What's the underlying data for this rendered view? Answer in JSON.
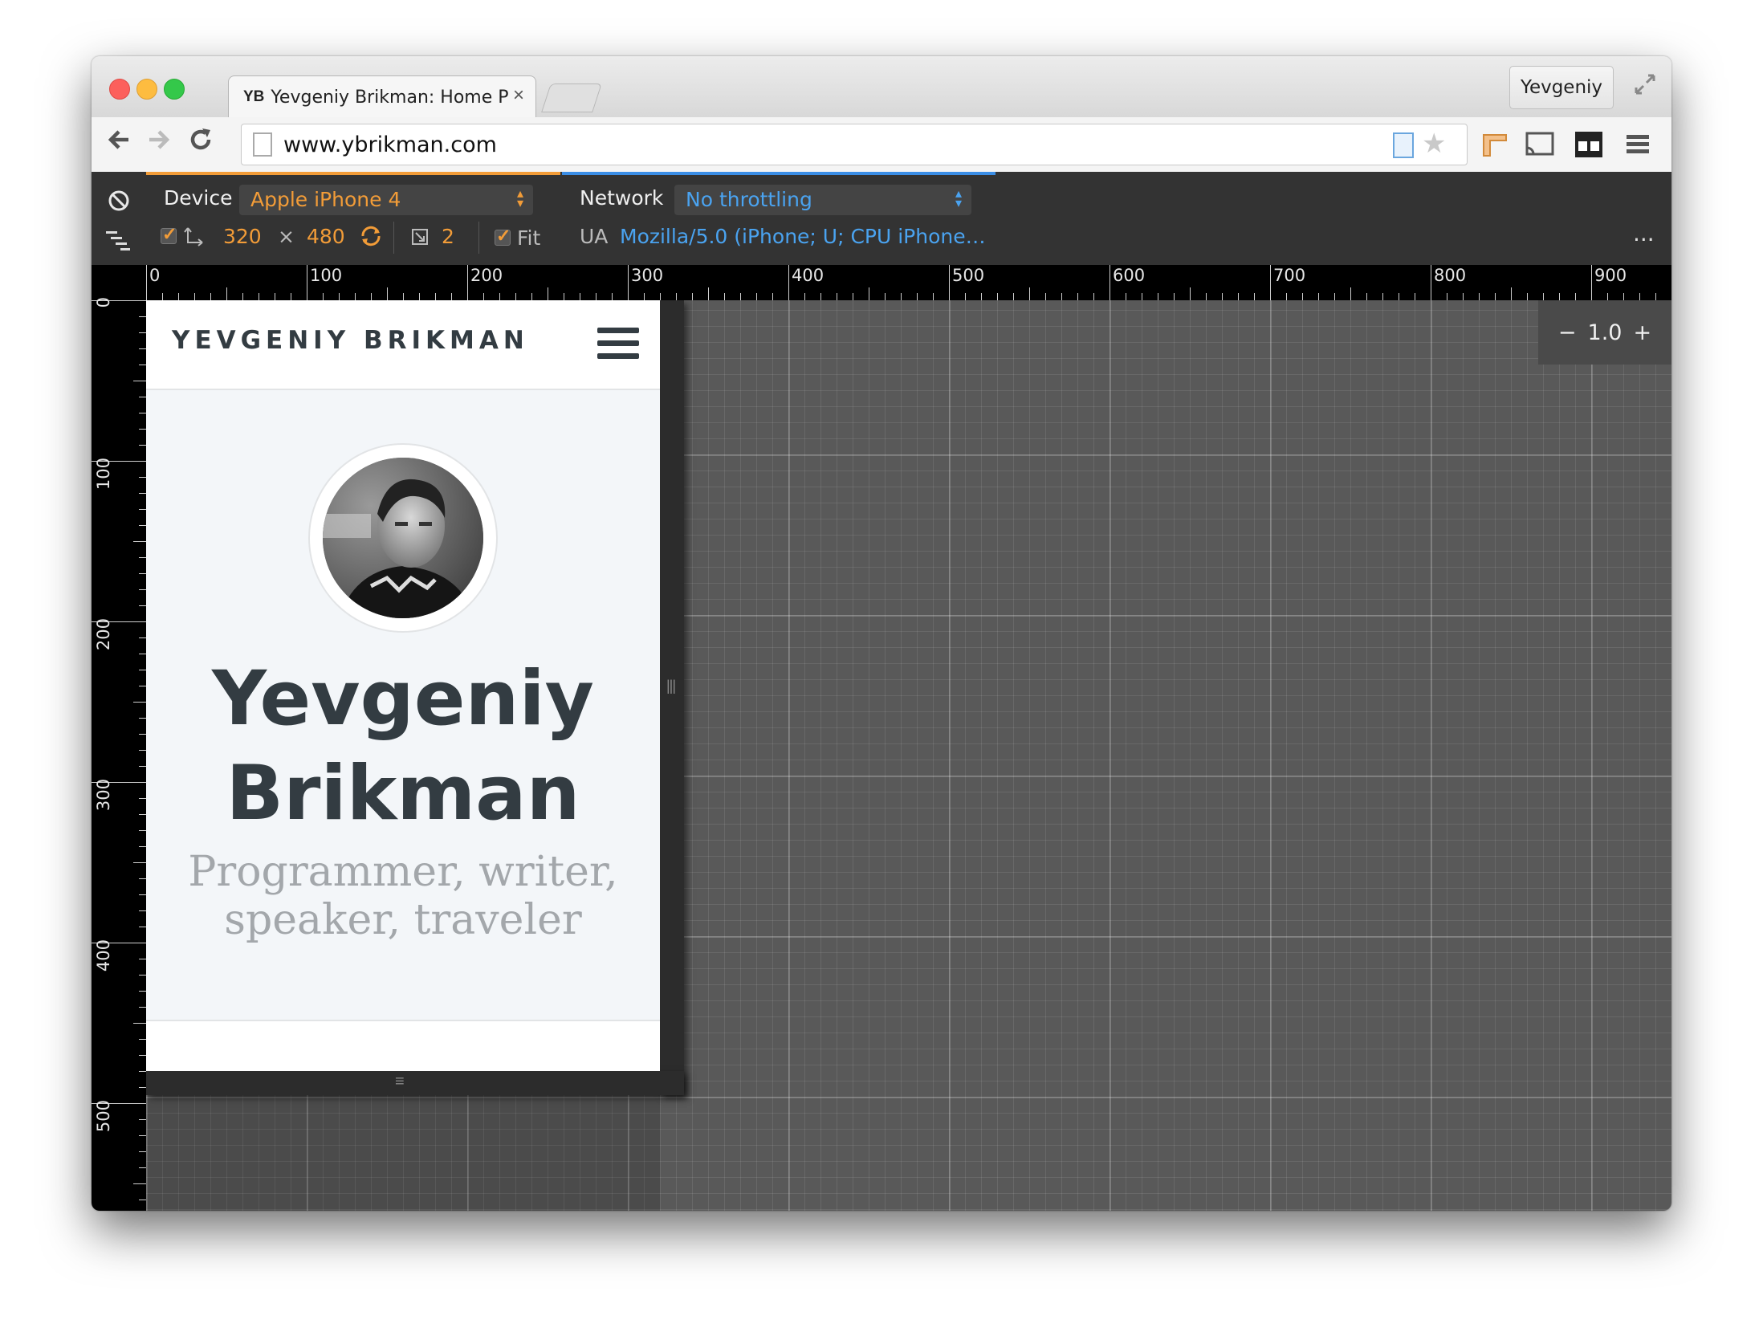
{
  "browser": {
    "tab": {
      "favicon_text": "YB",
      "title": "Yevgeniy Brikman: Home P",
      "close": "×"
    },
    "profile_name": "Yevgeniy",
    "url": "www.ybrikman.com"
  },
  "devtools": {
    "device_label": "Device",
    "device_value": "Apple iPhone 4",
    "width": "320",
    "times": "×",
    "height": "480",
    "pixel_ratio": "2",
    "fit_label": "Fit",
    "network_label": "Network",
    "network_value": "No throttling",
    "ua_label": "UA",
    "ua_value": "Mozilla/5.0 (iPhone; U; CPU iPhone…",
    "more": "...",
    "zoom_minus": "−",
    "zoom_value": "1.0",
    "zoom_plus": "+",
    "ruler_top_labels": [
      "0",
      "100",
      "200",
      "300",
      "400",
      "500",
      "600",
      "700",
      "800",
      "900"
    ],
    "ruler_left_labels": [
      "0",
      "100",
      "200",
      "300",
      "400",
      "500"
    ]
  },
  "site": {
    "logo": "YEVGENIY BRIKMAN",
    "name_line1": "Yevgeniy",
    "name_line2": "Brikman",
    "tagline_line1": "Programmer, writer,",
    "tagline_line2": "speaker, traveler"
  },
  "colors": {
    "device_accent": "#f29c38",
    "network_accent": "#3b8ee6",
    "devbar_bg": "#333333",
    "canvas_bg": "#595959"
  }
}
